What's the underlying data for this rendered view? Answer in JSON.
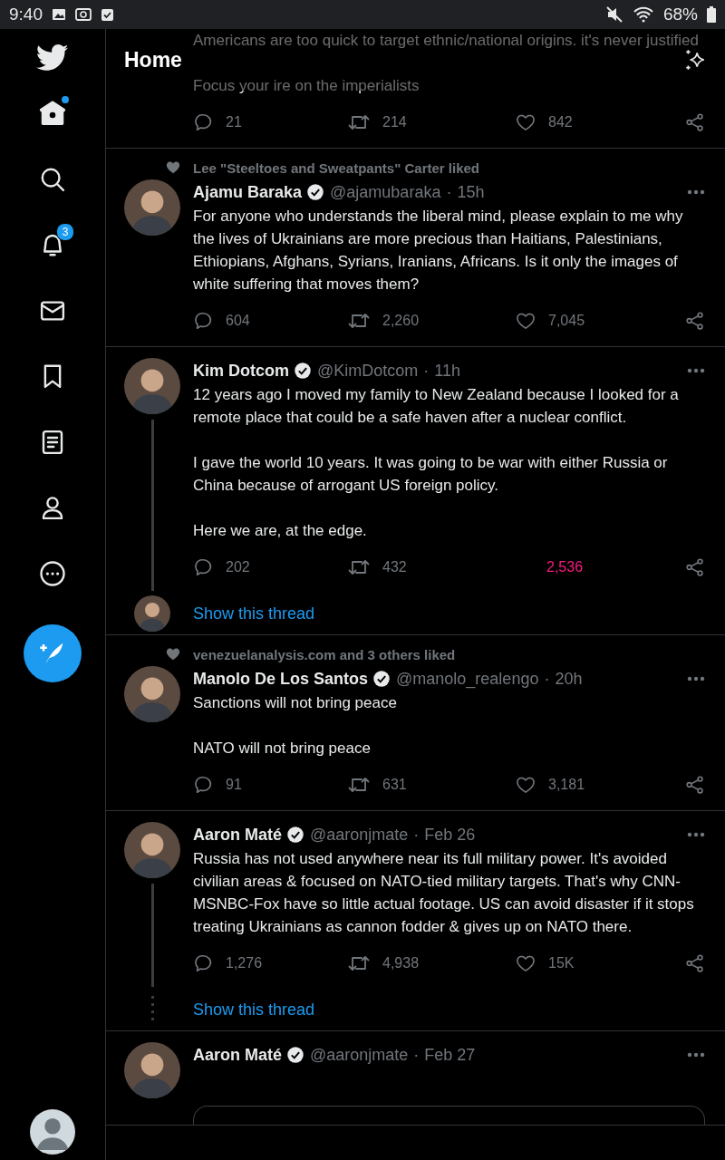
{
  "status_bar": {
    "time": "9:40",
    "battery": "68%"
  },
  "sidebar": {
    "items": [
      {
        "kind": "home",
        "selected": true,
        "unread": true
      },
      {
        "kind": "search",
        "selected": false
      },
      {
        "kind": "notifications",
        "selected": false,
        "badge": "3"
      },
      {
        "kind": "messages",
        "selected": false
      },
      {
        "kind": "bookmarks",
        "selected": false
      },
      {
        "kind": "lists",
        "selected": false
      },
      {
        "kind": "profile",
        "selected": false
      },
      {
        "kind": "more",
        "selected": false
      }
    ]
  },
  "header": {
    "title": "Home"
  },
  "tweets": [
    {
      "partial": true,
      "paragraphs": [
        "Americans are too quick to target ethnic/national origins. it's never justified",
        "Focus your ire on the imperialists"
      ],
      "replies": "21",
      "retweets": "214",
      "likes": "842",
      "liked": false
    },
    {
      "social_context": "Lee \"Steeltoes and Sweatpants\" Carter liked",
      "name": "Ajamu Baraka",
      "verified": true,
      "handle": "@ajamubaraka",
      "separator": "·",
      "time": "15h",
      "paragraphs": [
        "For anyone who understands the liberal mind, please explain to me why the lives of Ukrainians are more precious than Haitians, Palestinians, Ethiopians, Afghans, Syrians, Iranians, Africans. Is it only the images of white suffering that moves them?"
      ],
      "replies": "604",
      "retweets": "2,260",
      "likes": "7,045",
      "liked": false
    },
    {
      "name": "Kim Dotcom",
      "verified": true,
      "handle": "@KimDotcom",
      "separator": "·",
      "time": "11h",
      "paragraphs": [
        "12 years ago I moved my family to New Zealand because I looked for a remote place that could be a safe haven after a nuclear conflict.",
        "I gave the world 10 years. It was going to be war with either Russia or China because of arrogant US foreign policy.",
        "Here we are, at the edge."
      ],
      "replies": "202",
      "retweets": "432",
      "likes": "2,536",
      "liked": true,
      "show_thread": {
        "label": "Show this thread",
        "kind": "avatar"
      }
    },
    {
      "social_context": "venezuelanalysis.com and 3 others liked",
      "name": "Manolo De Los Santos",
      "verified": true,
      "handle": "@manolo_realengo",
      "separator": "·",
      "time": "20h",
      "paragraphs": [
        "Sanctions will not bring peace",
        "NATO will not bring peace"
      ],
      "replies": "91",
      "retweets": "631",
      "likes": "3,181",
      "liked": false
    },
    {
      "name": "Aaron Maté",
      "verified": true,
      "handle": "@aaronjmate",
      "separator": "·",
      "time": "Feb 26",
      "paragraphs": [
        "Russia has not used anywhere near its full military power. It's avoided civilian areas & focused on NATO-tied military targets. That's why CNN-MSNBC-Fox have so little actual footage. US can avoid disaster if it stops treating Ukrainians as cannon fodder & gives up on NATO there."
      ],
      "replies": "1,276",
      "retweets": "4,938",
      "likes": "15K",
      "liked": false,
      "show_thread": {
        "label": "Show this thread",
        "kind": "dotted"
      }
    },
    {
      "name": "Aaron Maté",
      "verified": true,
      "handle": "@aaronjmate",
      "separator": "·",
      "time": "Feb 27",
      "quoted_card": true
    }
  ]
}
